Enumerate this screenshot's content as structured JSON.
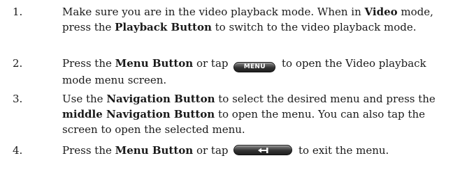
{
  "steps": [
    {
      "number": "1.",
      "t1": "Make sure you are in the video playback mode. When in ",
      "b1": "Video",
      "t2": " mode, press the ",
      "b2": "Playback Button",
      "t3": " to switch to the video playback mode."
    },
    {
      "number": "2.",
      "t1": "Press the ",
      "b1": "Menu Button",
      "t2": " or tap ",
      "button_label": "MENU",
      "t3": " to open the Video playback mode menu screen."
    },
    {
      "number": "3.",
      "t1": "Use the ",
      "b1": "Navigation Button",
      "t2": " to select the desired menu and press the ",
      "b2": "middle Navigation Button",
      "t3": " to open the menu. You can also tap the screen to open the selected menu."
    },
    {
      "number": "4.",
      "t1": "Press the ",
      "b1": "Menu Button",
      "t2": " or tap ",
      "button_icon": "back-arrow-icon",
      "t3": " to exit the menu."
    }
  ],
  "colors": {
    "text": "#1a1a1a",
    "button_dark": "#1e1e1e",
    "button_text": "#ffffff"
  }
}
